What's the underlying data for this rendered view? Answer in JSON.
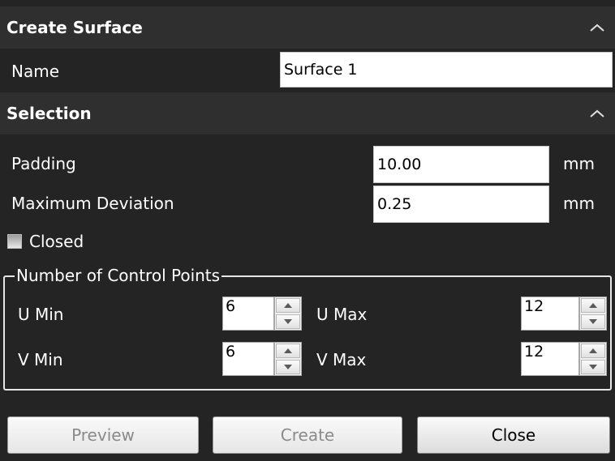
{
  "create_surface": {
    "header": "Create Surface",
    "name_label": "Name",
    "name_value": "Surface 1"
  },
  "selection": {
    "header": "Selection",
    "padding_label": "Padding",
    "padding_value": "10.00",
    "padding_unit": "mm",
    "deviation_label": "Maximum Deviation",
    "deviation_value": "0.25",
    "deviation_unit": "mm",
    "closed_label": "Closed",
    "closed_checked": false
  },
  "control_points": {
    "title": "Number of Control Points",
    "u_min_label": "U Min",
    "u_min_value": "6",
    "u_max_label": "U Max",
    "u_max_value": "12",
    "v_min_label": "V Min",
    "v_min_value": "6",
    "v_max_label": "V Max",
    "v_max_value": "12"
  },
  "buttons": {
    "preview": "Preview",
    "create": "Create",
    "close": "Close"
  },
  "icons": {
    "collapse": "chevron-up-icon",
    "spin_up": "triangle-up-icon",
    "spin_down": "triangle-down-icon"
  }
}
